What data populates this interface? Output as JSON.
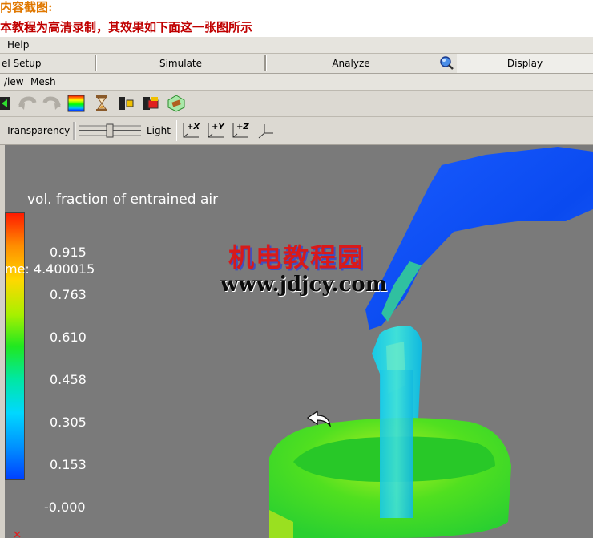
{
  "page": {
    "heading1": "内容截图:",
    "heading2": "本教程为高清录制，其效果如下面这一张图所示"
  },
  "menubar": {
    "help": "Help"
  },
  "tabs": [
    {
      "label": "el Setup"
    },
    {
      "label": "Simulate"
    },
    {
      "label": "Analyze"
    },
    {
      "label": "Display"
    }
  ],
  "menubar2": {
    "view": "/iew",
    "mesh": "Mesh"
  },
  "toolbar2": {
    "transparency_label": "-Transparency",
    "light_label": "Light",
    "light_level": 0.5,
    "view_buttons": [
      "+X",
      "+Y",
      "+Z"
    ]
  },
  "viewport": {
    "legend_title": "vol. fraction of entrained air",
    "time_text": "me: 4.400015",
    "ticks": [
      "0.915",
      "0.763",
      "0.610",
      "0.458",
      "0.305",
      "0.153",
      "-0.000"
    ],
    "watermark_cn": "机电教程园",
    "watermark_url": "www.jdjcy.com"
  },
  "colors": {
    "background": "#7a7a7a",
    "toolbar": "#dcd9d2"
  },
  "icons": [
    "green-arrow-icon",
    "undo-icon",
    "redo-icon",
    "color-map-icon",
    "hourglass-icon",
    "probe-icon",
    "clip-icon",
    "mesh-block-icon",
    "search-icon",
    "axis-icon",
    "mouse-cursor-icon",
    "axis-triad-icon"
  ]
}
